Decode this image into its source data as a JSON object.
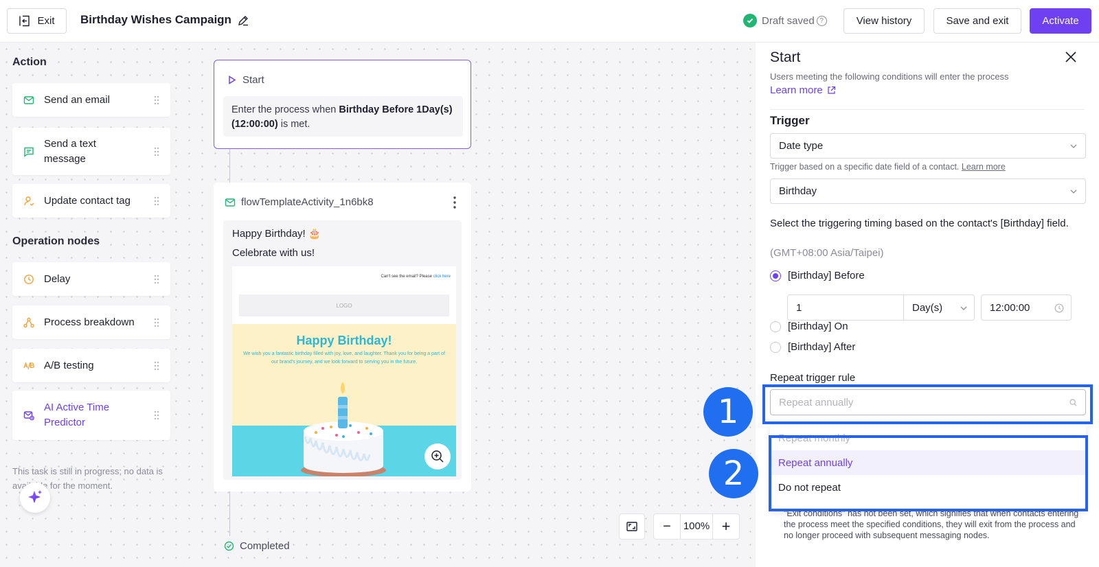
{
  "topbar": {
    "exit_label": "Exit",
    "campaign_title": "Birthday Wishes Campaign",
    "draft_status": "Draft saved",
    "help_glyph": "?",
    "view_history_label": "View history",
    "save_exit_label": "Save and exit",
    "activate_label": "Activate"
  },
  "palette": {
    "action_heading": "Action",
    "actions": [
      {
        "label": "Send an email",
        "icon": "mail-icon"
      },
      {
        "label": "Send a text message",
        "icon": "message-icon"
      },
      {
        "label": "Update contact tag",
        "icon": "user-tag-icon"
      }
    ],
    "operation_heading": "Operation nodes",
    "operations": [
      {
        "label": "Delay",
        "icon": "clock-icon"
      },
      {
        "label": "Process breakdown",
        "icon": "branch-icon"
      },
      {
        "label": "A/B testing",
        "icon": "ab-test-icon"
      },
      {
        "label": "AI Active Time Predictor",
        "icon": "ai-predictor-icon"
      }
    ],
    "progress_note": "This task is still in progress; no data is available for the moment."
  },
  "flow": {
    "start_label": "Start",
    "start_text_prefix": "Enter the process when ",
    "start_text_bold": "Birthday Before 1Day(s) (12:00:00)",
    "start_text_suffix": " is met.",
    "email_node_title": "flowTemplateActivity_1n6bk8",
    "email_subject": "Happy Birthday! 🎂",
    "email_preview": "Celebrate with us!",
    "thumb_cant_see": "Can't see the email? Please ",
    "thumb_click_here": "click here",
    "thumb_logo": "LOGO",
    "thumb_heading": "Happy Birthday!",
    "thumb_text": "We wish you a fantastic birthday filled with joy, love, and laughter. Thank you for being a part of our brand's journey, and we look forward to serving you in the future.",
    "completed_label": "Completed"
  },
  "canvas_controls": {
    "zoom_level": "100%",
    "zoom_out": "−",
    "zoom_in": "+"
  },
  "panel": {
    "title": "Start",
    "subtitle": "Users meeting the following conditions will enter the process",
    "learn_more": "Learn more",
    "trigger_heading": "Trigger",
    "trigger_type": "Date type",
    "trigger_hint": "Trigger based on a specific date field of a contact.",
    "trigger_hint_link": "Learn more",
    "date_field": "Birthday",
    "timing_label": "Select the triggering timing based on the contact's [Birthday] field.",
    "timezone": "(GMT+08:00 Asia/Taipei)",
    "options": [
      {
        "label": "[Birthday] Before",
        "selected": true
      },
      {
        "label": "[Birthday] On",
        "selected": false
      },
      {
        "label": "[Birthday] After",
        "selected": false
      }
    ],
    "offset_value": "1",
    "offset_unit": "Day(s)",
    "offset_time": "12:00:00",
    "repeat_label": "Repeat trigger rule",
    "repeat_placeholder": "Repeat annually",
    "repeat_options": [
      {
        "label": "Repeat monthly",
        "state": "disabled"
      },
      {
        "label": "Repeat annually",
        "state": "selected"
      },
      {
        "label": "Do not repeat",
        "state": "normal"
      }
    ],
    "exit_note": "\"Exit conditions\" has not been set, which signifies that when contacts entering the process meet the specified conditions, they will exit from the process and no longer proceed with subsequent messaging nodes."
  },
  "annotations": {
    "badge_1": "1",
    "badge_2": "2",
    "color": "#2563eb"
  },
  "colors": {
    "accent": "#6e40f2",
    "success": "#22b573"
  }
}
